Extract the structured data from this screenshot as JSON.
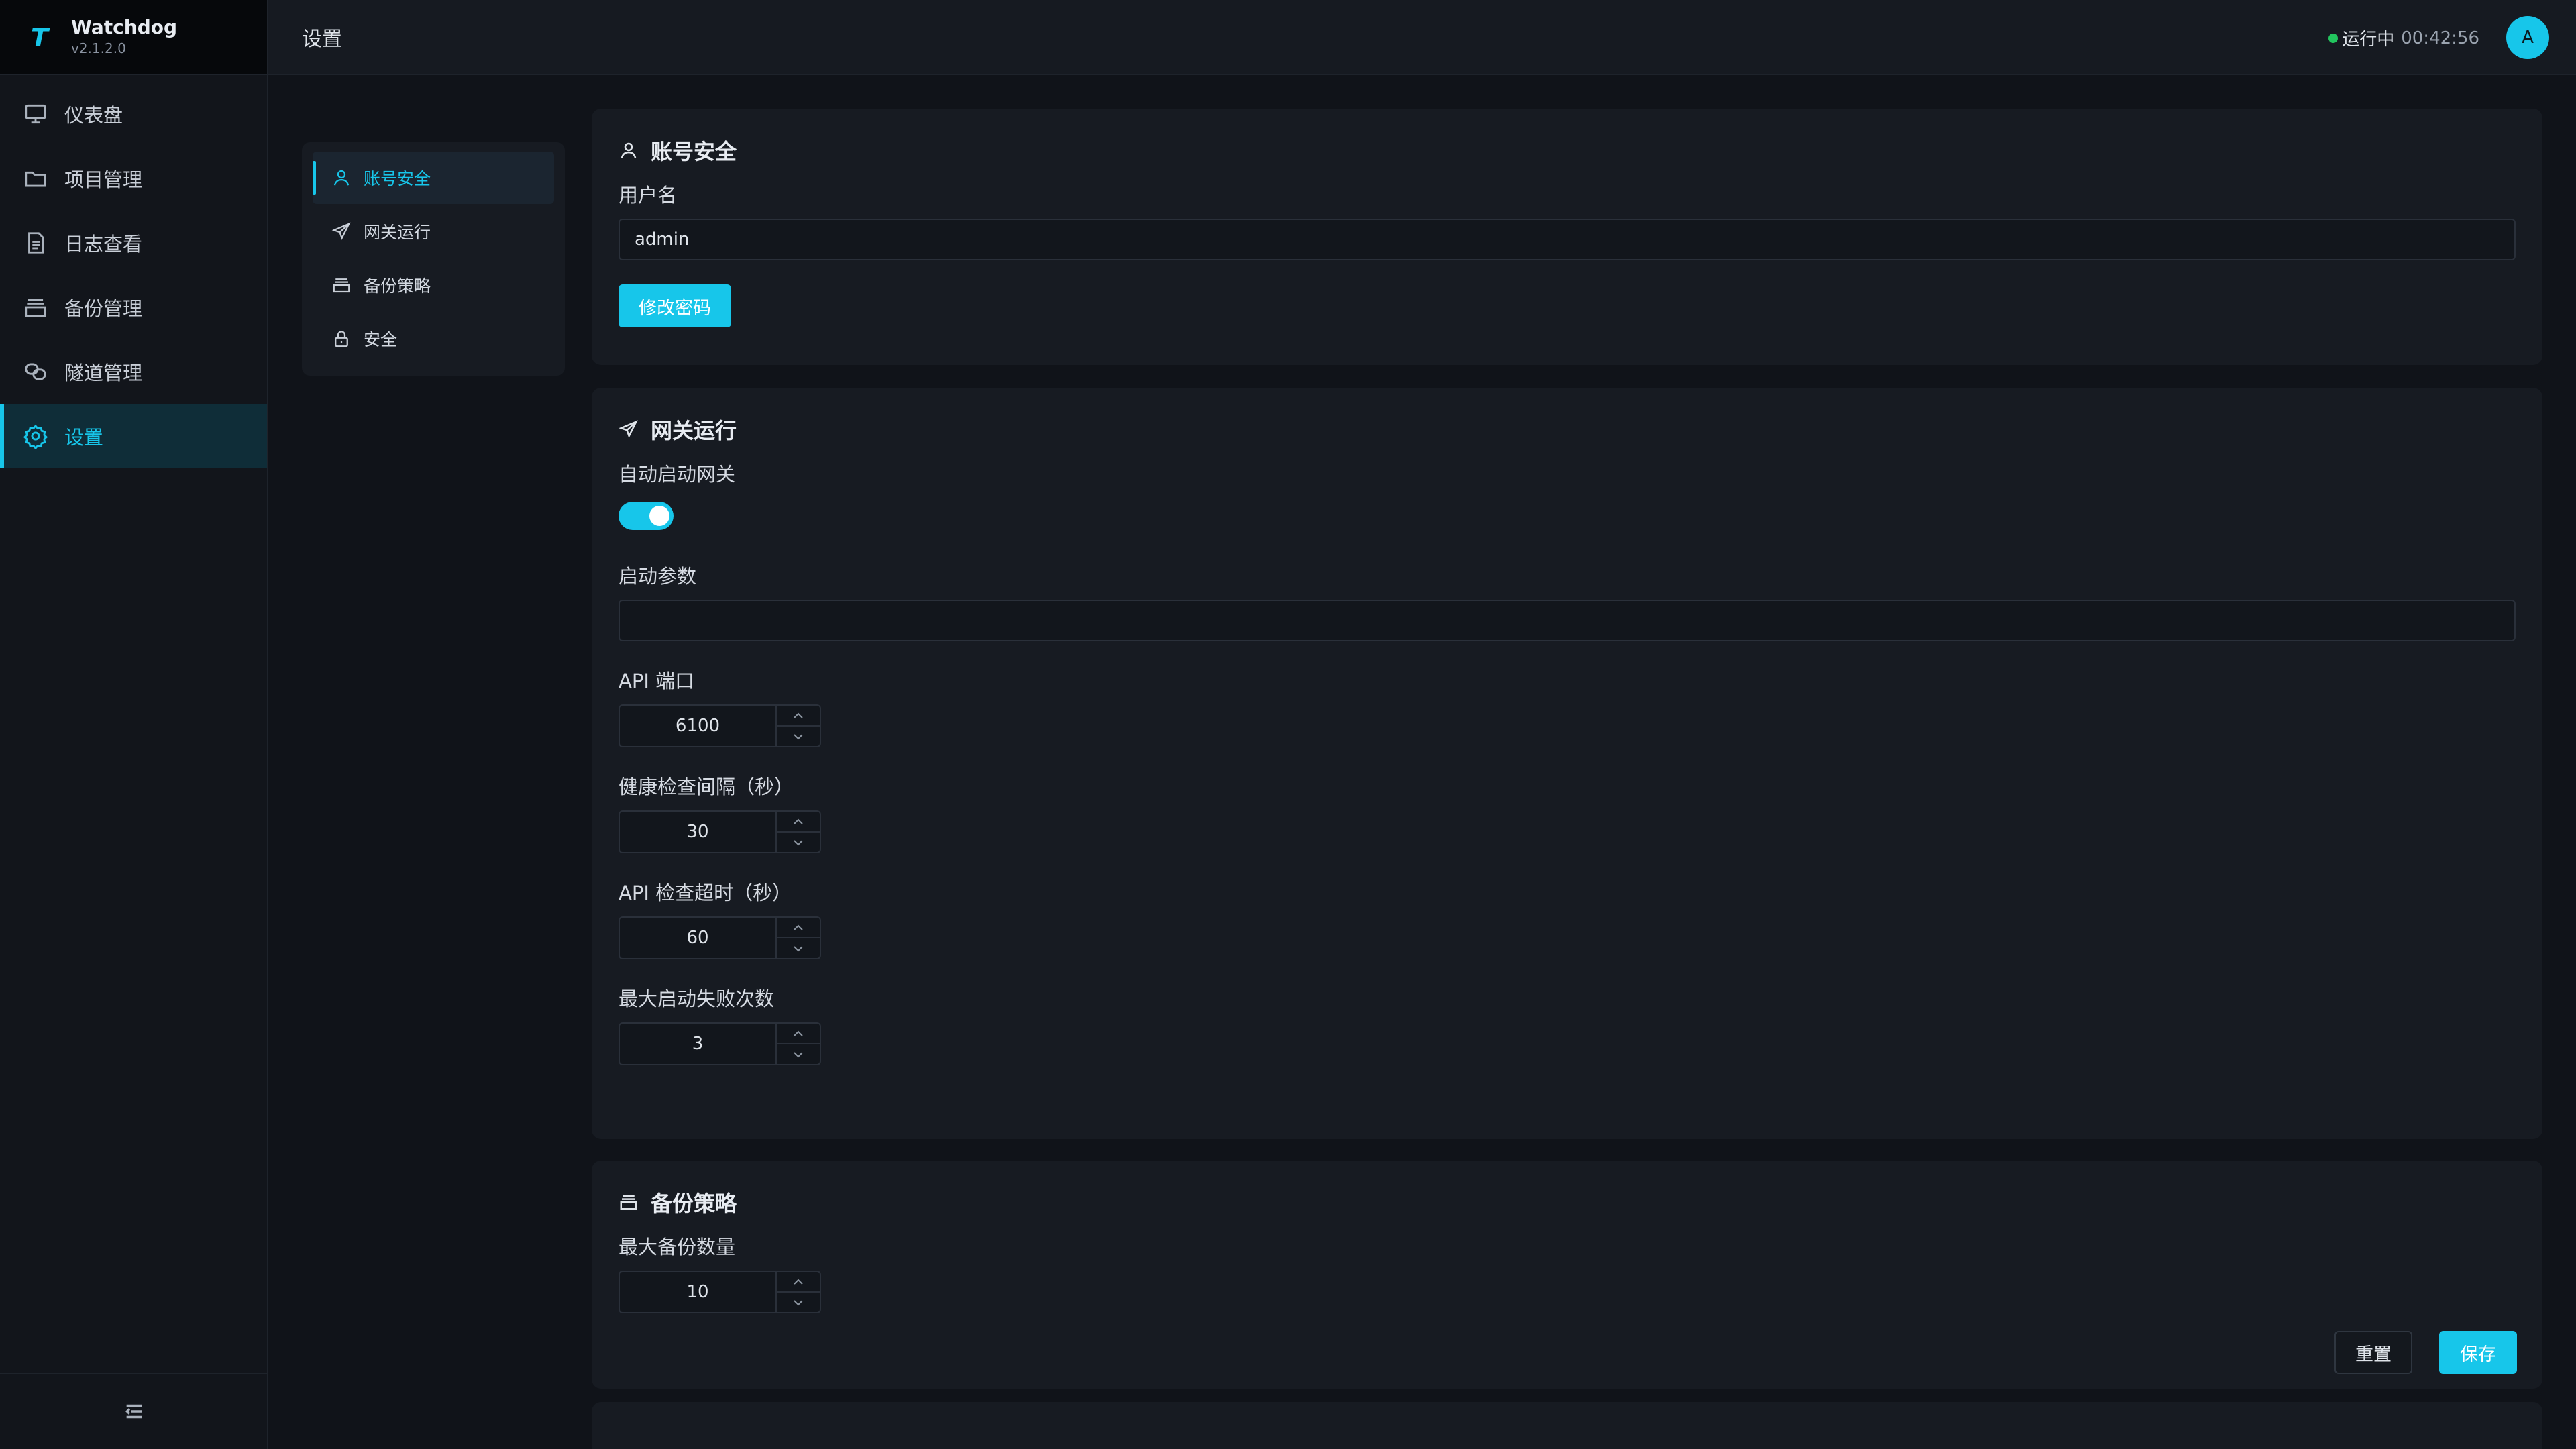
{
  "brand": {
    "name": "Watchdog",
    "version": "v2.1.2.0",
    "logo_letter": "T"
  },
  "sidebar": {
    "items": [
      {
        "label": "仪表盘",
        "icon": "monitor-icon"
      },
      {
        "label": "项目管理",
        "icon": "folder-icon"
      },
      {
        "label": "日志查看",
        "icon": "file-text-icon"
      },
      {
        "label": "备份管理",
        "icon": "archive-icon"
      },
      {
        "label": "隧道管理",
        "icon": "link-icon"
      },
      {
        "label": "设置",
        "icon": "gear-icon",
        "active": true
      }
    ],
    "collapse_icon": "collapse-menu-icon"
  },
  "header": {
    "title": "设置",
    "status": {
      "label": "运行中",
      "uptime": "00:42:56",
      "color": "#22c55e"
    },
    "avatar": "A"
  },
  "subnav": {
    "items": [
      {
        "label": "账号安全",
        "icon": "user-icon",
        "active": true
      },
      {
        "label": "网关运行",
        "icon": "send-icon"
      },
      {
        "label": "备份策略",
        "icon": "archive-icon"
      },
      {
        "label": "安全",
        "icon": "lock-icon"
      }
    ]
  },
  "account": {
    "title": "账号安全",
    "username_label": "用户名",
    "username_value": "admin",
    "change_password": "修改密码"
  },
  "gateway": {
    "title": "网关运行",
    "autostart_label": "自动启动网关",
    "autostart_on": true,
    "args_label": "启动参数",
    "args_value": "",
    "api_port_label": "API 端口",
    "api_port": "6100",
    "health_interval_label": "健康检查间隔（秒）",
    "health_interval": "30",
    "api_timeout_label": "API 检查超时（秒）",
    "api_timeout": "60",
    "max_fail_label": "最大启动失败次数",
    "max_fail": "3"
  },
  "backup": {
    "title": "备份策略",
    "max_count_label": "最大备份数量",
    "max_count": "10"
  },
  "actions": {
    "reset": "重置",
    "save": "保存"
  },
  "colors": {
    "accent": "#17c6ea",
    "background": "#101319",
    "card": "#171b22"
  }
}
